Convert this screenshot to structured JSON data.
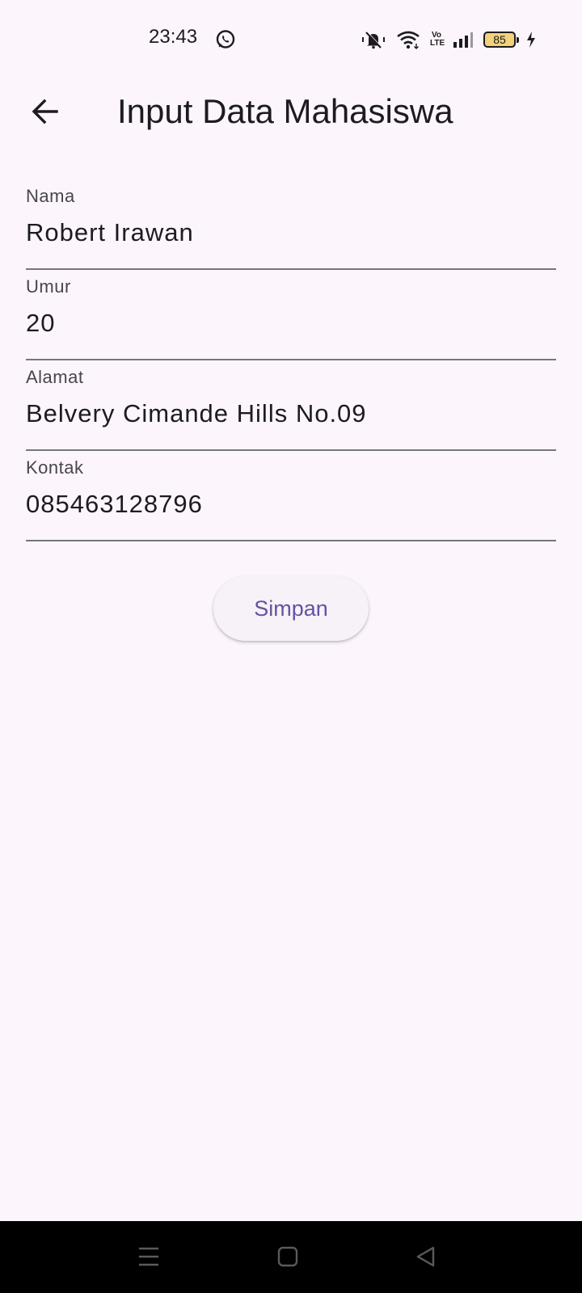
{
  "status_bar": {
    "time": "23:43",
    "battery_level": "85",
    "icons": [
      "whatsapp-icon",
      "mute-icon",
      "wifi-icon",
      "volte-icon",
      "signal-icon",
      "battery-icon",
      "charging-icon"
    ],
    "volte_top": "Vo",
    "volte_bottom": "LTE"
  },
  "app_bar": {
    "title": "Input Data Mahasiswa",
    "back_icon": "arrow-left-icon"
  },
  "form": {
    "fields": [
      {
        "label": "Nama",
        "value": "Robert Irawan"
      },
      {
        "label": "Umur",
        "value": "20"
      },
      {
        "label": "Alamat",
        "value": "Belvery Cimande Hills No.09"
      },
      {
        "label": "Kontak",
        "value": "085463128796"
      }
    ],
    "submit_label": "Simpan"
  },
  "nav_bar": {
    "buttons": [
      "menu-icon",
      "home-icon",
      "back-triangle-icon"
    ]
  },
  "colors": {
    "background": "#fcf6fc",
    "accent": "#6750a4",
    "text": "#1d1b20",
    "label": "#49454f",
    "underline": "#79757d",
    "battery": "#f2d27a"
  }
}
